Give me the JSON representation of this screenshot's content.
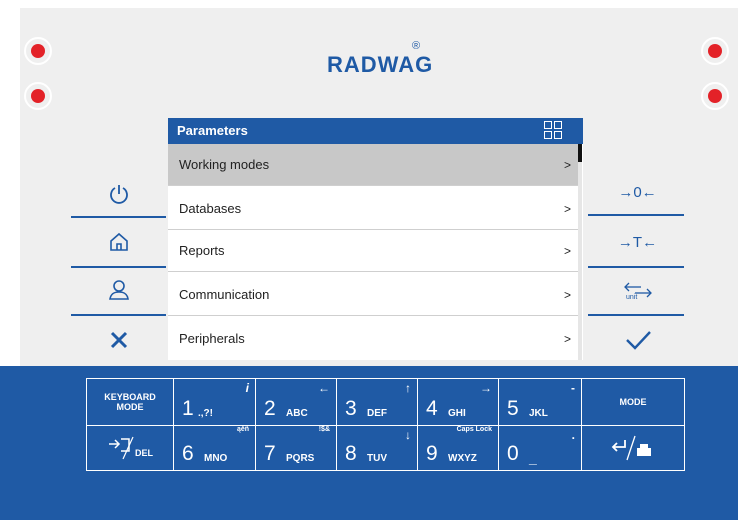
{
  "brand": {
    "logo_text": "RADWAG",
    "registered": "®"
  },
  "colors": {
    "accent": "#1f5aa5",
    "led": "#e32228",
    "panel": "#efefef",
    "selected_row": "#c8c8c8"
  },
  "screen": {
    "title": "Parameters",
    "header_icon": "multi-window-icon",
    "menu": [
      {
        "label": "Working modes",
        "arrow": ">"
      },
      {
        "label": "Databases",
        "arrow": ">"
      },
      {
        "label": "Reports",
        "arrow": ">"
      },
      {
        "label": "Communication",
        "arrow": ">"
      },
      {
        "label": "Peripherals",
        "arrow": ">"
      }
    ],
    "selected_index": 0
  },
  "left_buttons": [
    {
      "name": "power-icon"
    },
    {
      "name": "home-icon"
    },
    {
      "name": "user-icon"
    },
    {
      "name": "close-icon"
    }
  ],
  "right_buttons": [
    {
      "name": "zero-icon",
      "label": "→0←"
    },
    {
      "name": "tare-icon",
      "label": "→T←"
    },
    {
      "name": "unit-icon",
      "label": "unit"
    },
    {
      "name": "confirm-icon"
    }
  ],
  "keyboard": {
    "mode_key": {
      "line1": "KEYBOARD",
      "line2": "MODE"
    },
    "del_key": {
      "label": "DEL"
    },
    "mode_right": {
      "label": "MODE"
    },
    "keys": [
      {
        "num": "1",
        "letters": ".,?!",
        "corner": "i"
      },
      {
        "num": "2",
        "letters": "ABC",
        "corner": "←"
      },
      {
        "num": "3",
        "letters": "DEF",
        "corner": "↑"
      },
      {
        "num": "4",
        "letters": "GHI",
        "corner": "→"
      },
      {
        "num": "5",
        "letters": "JKL",
        "corner": "-"
      },
      {
        "num": "6",
        "letters": "MNO",
        "corner": "ąěñ"
      },
      {
        "num": "7",
        "letters": "PQRS",
        "corner": "!$&"
      },
      {
        "num": "8",
        "letters": "TUV",
        "corner": "↓"
      },
      {
        "num": "9",
        "letters": "WXYZ",
        "corner": "Caps Lock"
      },
      {
        "num": "0",
        "letters": "_",
        "corner": "."
      }
    ]
  }
}
